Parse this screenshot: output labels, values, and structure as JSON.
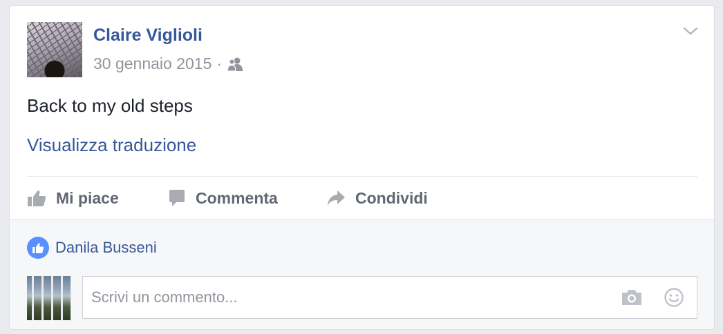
{
  "post": {
    "author": "Claire Viglioli",
    "date": "30 gennaio 2015",
    "separator": "·",
    "audience_icon": "friends-icon",
    "text": "Back to my old steps",
    "translate_link": "Visualizza traduzione"
  },
  "actions": {
    "like_label": "Mi piace",
    "comment_label": "Commenta",
    "share_label": "Condividi"
  },
  "likes": {
    "names": "Danila Busseni",
    "icon": "thumbs-up-icon"
  },
  "comment_input": {
    "placeholder": "Scrivi un commento...",
    "value": "",
    "icons": [
      "camera-icon",
      "smiley-icon"
    ]
  },
  "colors": {
    "link": "#365899",
    "secondary_text": "#90949c",
    "action_text": "#606770",
    "like_badge": "#5890ff",
    "footer_bg": "#f6f7f9"
  }
}
